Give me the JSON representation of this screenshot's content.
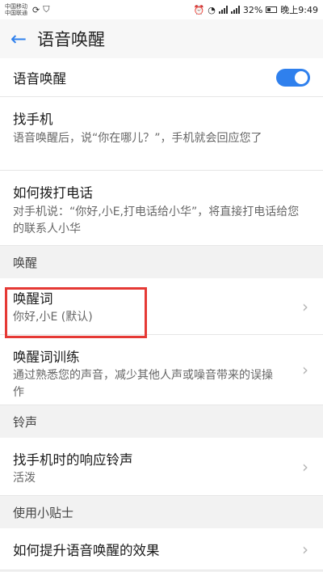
{
  "status_bar": {
    "carrier1": "中国移动",
    "carrier2": "中国联通",
    "battery": "32%",
    "time": "晚上9:49"
  },
  "header": {
    "title": "语音唤醒"
  },
  "rows": {
    "voice_wake": {
      "title": "语音唤醒",
      "toggle_on": true
    },
    "find_phone": {
      "title": "找手机",
      "subtitle": "语音唤醒后，说“你在哪儿？”，手机就会回应您了"
    },
    "call": {
      "title": "如何拨打电话",
      "subtitle": "对手机说：“你好,小E,打电话给小华”，将直接打电话给您的联系人小华"
    },
    "wake_word": {
      "title": "唤醒词",
      "subtitle": "你好,小E (默认)"
    },
    "wake_training": {
      "title": "唤醒词训练",
      "subtitle": "通过熟悉您的声音，减少其他人声或噪音带来的误操作"
    },
    "find_ringtone": {
      "title": "找手机时的响应铃声",
      "subtitle": "活泼"
    },
    "tips_improve": {
      "title": "如何提升语音唤醒的效果"
    }
  },
  "sections": {
    "wake": "唤醒",
    "ringtone": "铃声",
    "tips": "使用小贴士"
  },
  "colors": {
    "accent": "#2f80ed",
    "highlight": "#e53935"
  }
}
